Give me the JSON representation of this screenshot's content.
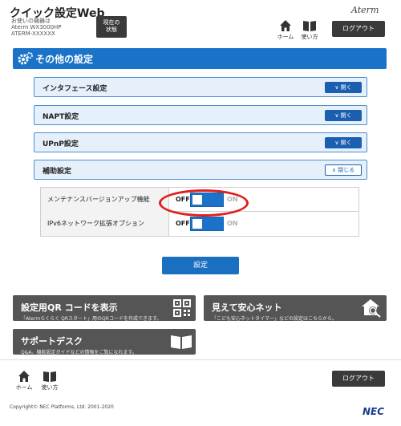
{
  "header": {
    "title": "クイック設定Web",
    "device_caption": [
      "お使いの機器は",
      "Aterm WX3000HP",
      "ATERM-XXXXXX"
    ],
    "status_button": [
      "現在の",
      "状態"
    ],
    "brand": "Aterm",
    "home_label": "ホーム",
    "manual_label": "使い方",
    "logout_label": "ログアウト"
  },
  "section": {
    "title": "その他の設定"
  },
  "accordions": [
    {
      "label": "インタフェース設定",
      "toggle": "開く"
    },
    {
      "label": "NAPT設定",
      "toggle": "開く"
    },
    {
      "label": "UPnP設定",
      "toggle": "開く"
    },
    {
      "label": "補助設定",
      "toggle": "閉じる"
    }
  ],
  "settings": [
    {
      "label": "メンテナンスバージョンアップ機能",
      "off": "OFF",
      "on": "ON"
    },
    {
      "label": "IPv6ネットワーク拡張オプション",
      "off": "OFF",
      "on": "ON"
    }
  ],
  "apply_label": "設定",
  "tiles": [
    {
      "title": "設定用QR コードを表示",
      "desc": "「Atermらくらく QRスタート」用のQRコードを作成できます。",
      "icon": "qr-code-icon"
    },
    {
      "title": "見えて安心ネット",
      "desc": "「こども安心ネットタイマー」などの設定はこちらから。",
      "icon": "house-search-icon"
    },
    {
      "title": "サポートデスク",
      "desc": "Q&A、機能設定ガイドなどの情報をご覧になれます。",
      "icon": "book-icon"
    }
  ],
  "footer": {
    "home_label": "ホーム",
    "manual_label": "使い方",
    "logout_label": "ログアウト",
    "copyright": "Copyright© NEC Platforms, Ltd. 2001-2020",
    "nec": "NEC"
  },
  "colors": {
    "primary": "#1a73c8",
    "tile": "#555555",
    "highlight": "#e0201c"
  }
}
